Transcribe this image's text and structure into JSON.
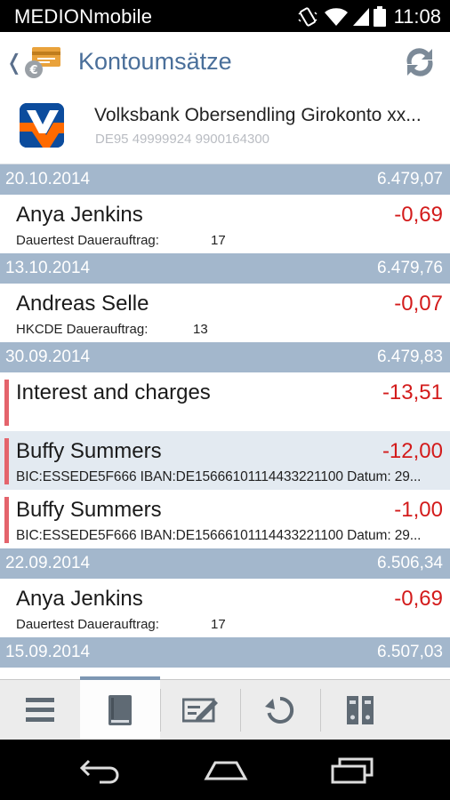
{
  "status_bar": {
    "carrier": "MEDIONmobile",
    "time": "11:08"
  },
  "header": {
    "back_glyph": "❬",
    "title": "Kontoumsätze",
    "app_icon": "card-euro-icon",
    "sync_icon": "sync-icon"
  },
  "account": {
    "name": "Volksbank Obersendling Girokonto xx...",
    "iban": "DE95 49999924 9900164300",
    "logo": "volksbank-logo"
  },
  "groups": [
    {
      "date": "20.10.2014",
      "balance": "6.479,07",
      "transactions": [
        {
          "party": "Anya Jenkins",
          "amount": "-0,69",
          "detail": "Dauertest Dauerauftrag:",
          "detail_num": "17"
        }
      ]
    },
    {
      "date": "13.10.2014",
      "balance": "6.479,76",
      "transactions": [
        {
          "party": "Andreas Selle",
          "amount": "-0,07",
          "detail": "HKCDE Dauerauftrag:",
          "detail_num": "13"
        }
      ]
    },
    {
      "date": "30.09.2014",
      "balance": "6.479,83",
      "transactions": [
        {
          "party": "Interest and charges",
          "amount": "-13,51"
        },
        {
          "party": "Buffy Summers",
          "amount": "-12,00",
          "detail": "BIC:ESSEDE5F666 IBAN:DE15666101114433221100 Datum: 29..."
        },
        {
          "party": "Buffy Summers",
          "amount": "-1,00",
          "detail": "BIC:ESSEDE5F666 IBAN:DE15666101114433221100 Datum: 29..."
        }
      ]
    },
    {
      "date": "22.09.2014",
      "balance": "6.506,34",
      "transactions": [
        {
          "party": "Anya Jenkins",
          "amount": "-0,69",
          "detail": "Dauertest Dauerauftrag:",
          "detail_num": "17"
        }
      ]
    },
    {
      "date": "15.09.2014",
      "balance": "6.507,03"
    }
  ],
  "tabs": [
    {
      "icon": "menu-icon"
    },
    {
      "icon": "account-book-icon",
      "active": true
    },
    {
      "icon": "transfer-form-icon"
    },
    {
      "icon": "refresh-icon"
    },
    {
      "icon": "binders-icon"
    }
  ],
  "nav": [
    "back-icon",
    "home-icon",
    "recent-apps-icon"
  ],
  "colors": {
    "accent": "#4a6f9a",
    "date_header": "#a3b7cc",
    "negative": "#d31b1b",
    "marker": "#e4646c",
    "selected_row": "#e3eaf1"
  }
}
